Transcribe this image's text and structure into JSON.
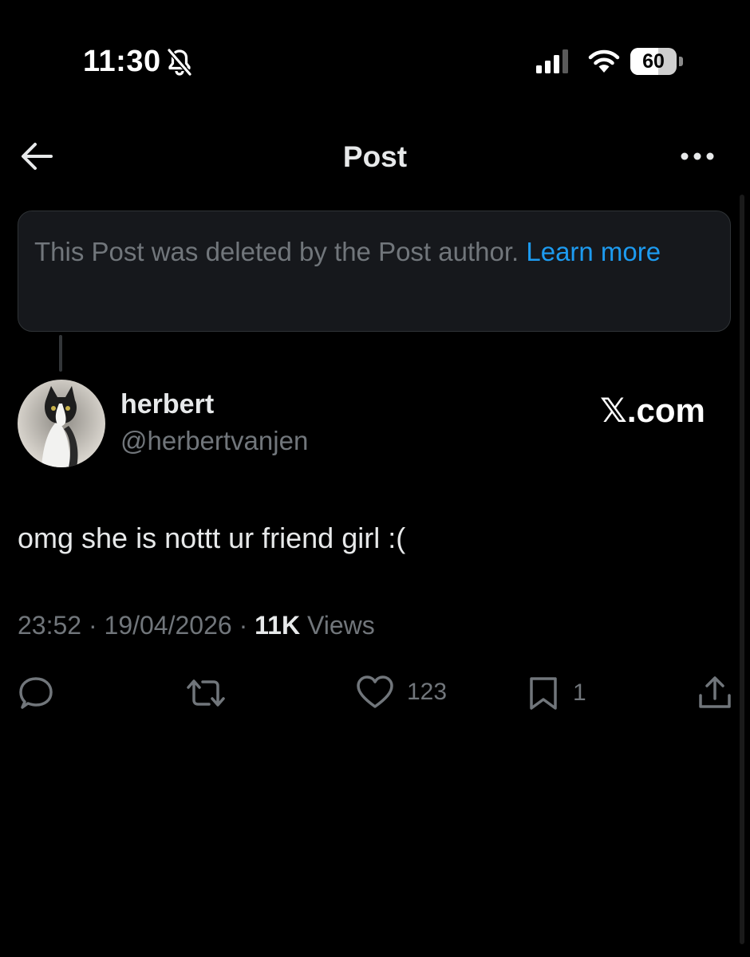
{
  "status_bar": {
    "time": "11:30",
    "battery_label": "60",
    "battery_level_percent": 60
  },
  "header": {
    "title": "Post"
  },
  "deleted_notice": {
    "text": "This Post was deleted by the Post author. ",
    "link": "Learn more"
  },
  "author": {
    "name": "herbert",
    "handle": "@herbertvanjen"
  },
  "watermark": "𝕏.com",
  "post": {
    "text": "omg she is nottt ur friend girl :(",
    "time": "23:52",
    "separator": "·",
    "date": "19/04/2026",
    "views_count": "11K",
    "views_label": "Views"
  },
  "actions": {
    "likes": "123",
    "bookmarks": "1"
  },
  "colors": {
    "background": "#000000",
    "text": "#e7e9ea",
    "secondary": "#71767b",
    "link": "#1d9bf0",
    "card": "#16181c",
    "border": "#2f3336"
  },
  "icons": [
    "bell-slash-icon",
    "signal-icon",
    "wifi-icon",
    "battery-icon",
    "back-arrow-icon",
    "more-icon",
    "reply-icon",
    "repost-icon",
    "like-icon",
    "bookmark-icon",
    "share-icon"
  ]
}
